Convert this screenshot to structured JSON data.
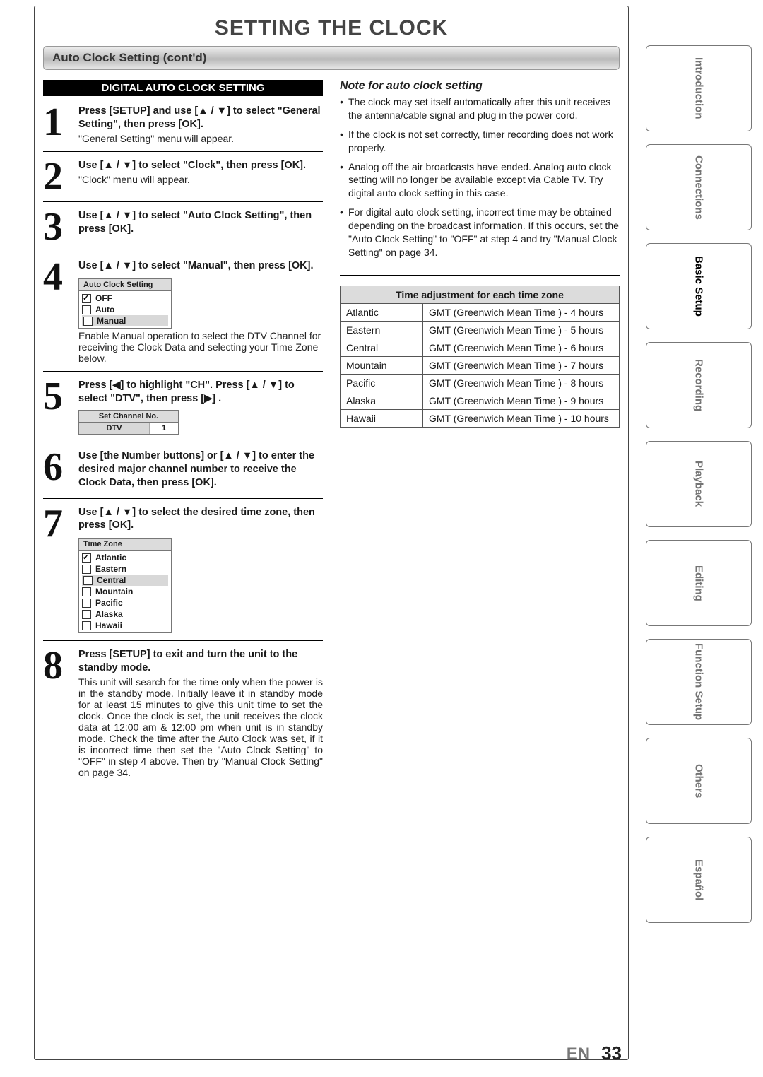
{
  "page_title": "SETTING THE CLOCK",
  "section_title": "Auto Clock Setting (cont'd)",
  "subhead": "DIGITAL AUTO CLOCK SETTING",
  "steps": [
    {
      "num": "1",
      "head": "Press [SETUP] and use [▲ / ▼] to select \"General Setting\", then press [OK].",
      "sub": "\"General Setting\" menu will appear."
    },
    {
      "num": "2",
      "head": "Use [▲ / ▼] to select \"Clock\", then press [OK].",
      "sub": "\"Clock\" menu will appear."
    },
    {
      "num": "3",
      "head": "Use [▲ / ▼] to select \"Auto Clock Setting\", then press [OK].",
      "sub": ""
    },
    {
      "num": "4",
      "head": "Use [▲ / ▼] to select \"Manual\", then press [OK].",
      "sub": "Enable Manual operation to select the DTV Channel for receiving the Clock Data and selecting your Time Zone below.",
      "menu": {
        "title": "Auto Clock Setting",
        "items": [
          {
            "label": "OFF",
            "checked": true,
            "sel": false
          },
          {
            "label": "Auto",
            "checked": false,
            "sel": false
          },
          {
            "label": "Manual",
            "checked": false,
            "sel": true
          }
        ]
      }
    },
    {
      "num": "5",
      "head": "Press [◀] to highlight \"CH\".  Press [▲ / ▼] to select \"DTV\", then press [▶] .",
      "sub": "",
      "setch": {
        "title": "Set Channel No.",
        "left": "DTV",
        "right": "1"
      }
    },
    {
      "num": "6",
      "head": "Use [the Number buttons] or [▲ / ▼] to enter the desired major channel number to receive the Clock Data, then press [OK].",
      "sub": ""
    },
    {
      "num": "7",
      "head": "Use [▲ / ▼] to select the desired time zone, then press [OK].",
      "sub": "",
      "menu": {
        "title": "Time Zone",
        "items": [
          {
            "label": "Atlantic",
            "checked": true,
            "sel": false
          },
          {
            "label": "Eastern",
            "checked": false,
            "sel": false
          },
          {
            "label": "Central",
            "checked": false,
            "sel": true
          },
          {
            "label": "Mountain",
            "checked": false,
            "sel": false
          },
          {
            "label": "Pacific",
            "checked": false,
            "sel": false
          },
          {
            "label": "Alaska",
            "checked": false,
            "sel": false
          },
          {
            "label": "Hawaii",
            "checked": false,
            "sel": false
          }
        ]
      }
    },
    {
      "num": "8",
      "head": "Press [SETUP] to exit and turn the unit to the standby mode.",
      "sub": "This unit will search for the time only when the power is in the standby mode. Initially leave it in standby mode for at least 15 minutes to give this unit time to set the clock. Once the clock is set, the unit receives the clock data at 12:00 am & 12:00 pm when unit is in standby mode. Check the time after the Auto Clock was set, if it is incorrect time then set the \"Auto Clock Setting\" to \"OFF\" in step 4 above. Then try \"Manual Clock Setting\" on page 34."
    }
  ],
  "note_title": "Note for auto clock setting",
  "notes": [
    "The clock may set itself automatically after this unit receives the antenna/cable signal and plug in the power cord.",
    "If the clock is not set correctly, timer recording does not work properly.",
    "Analog off the air broadcasts have ended. Analog auto clock setting will no longer be available except via Cable TV. Try digital auto clock setting in this case.",
    "For digital auto clock setting, incorrect time may be obtained depending on the broadcast information. If this occurs, set the \"Auto Clock Setting\" to \"OFF\" at step 4 and try \"Manual Clock Setting\" on page 34."
  ],
  "tz_table": {
    "head": "Time adjustment for each time zone",
    "rows": [
      [
        "Atlantic",
        "GMT (Greenwich Mean Time ) - 4 hours"
      ],
      [
        "Eastern",
        "GMT (Greenwich Mean Time ) - 5 hours"
      ],
      [
        "Central",
        "GMT (Greenwich Mean Time ) - 6 hours"
      ],
      [
        "Mountain",
        "GMT (Greenwich Mean Time ) - 7 hours"
      ],
      [
        "Pacific",
        "GMT (Greenwich Mean Time ) - 8 hours"
      ],
      [
        "Alaska",
        "GMT (Greenwich Mean Time ) - 9 hours"
      ],
      [
        "Hawaii",
        "GMT (Greenwich Mean Time ) - 10 hours"
      ]
    ]
  },
  "side_tabs": [
    {
      "label": "Introduction",
      "active": false
    },
    {
      "label": "Connections",
      "active": false
    },
    {
      "label": "Basic Setup",
      "active": true
    },
    {
      "label": "Recording",
      "active": false
    },
    {
      "label": "Playback",
      "active": false
    },
    {
      "label": "Editing",
      "active": false
    },
    {
      "label": "Function Setup",
      "active": false
    },
    {
      "label": "Others",
      "active": false
    },
    {
      "label": "Español",
      "active": false
    }
  ],
  "footer": {
    "lang": "EN",
    "page": "33"
  }
}
